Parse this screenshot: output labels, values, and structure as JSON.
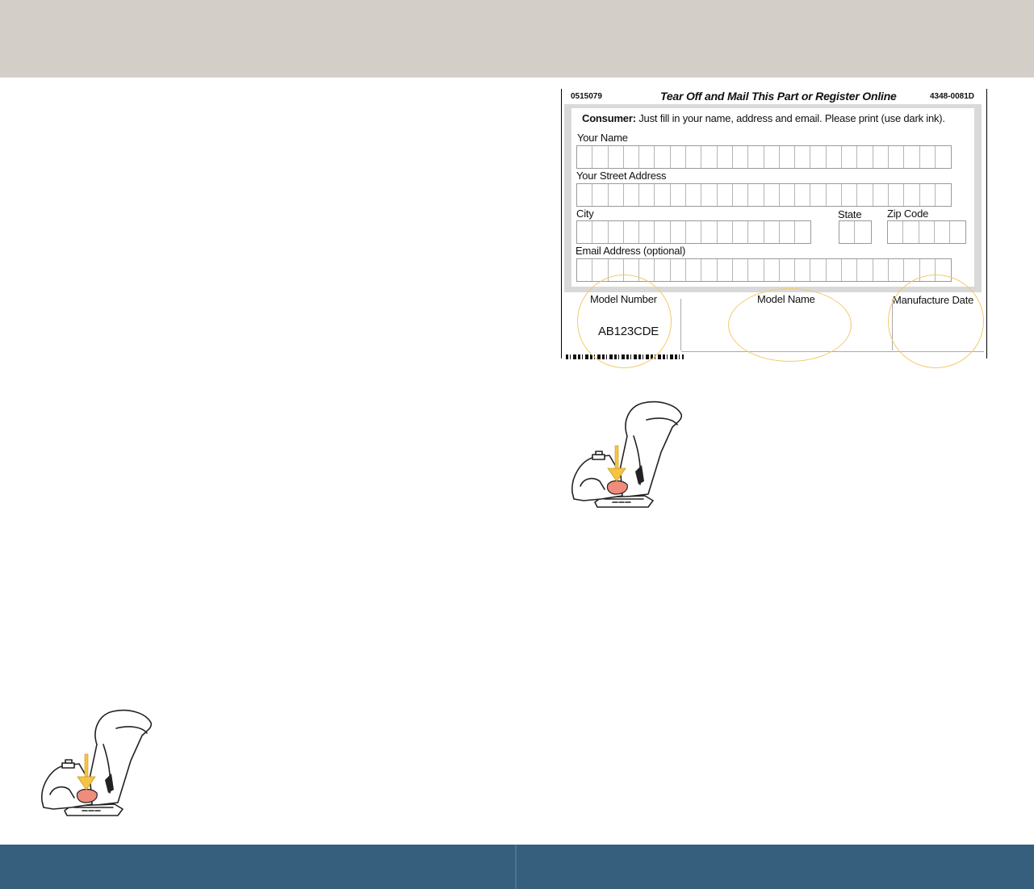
{
  "card": {
    "code_left": "0515079",
    "title": "Tear Off and Mail This Part or Register Online",
    "code_right": "4348-0081D",
    "consumer_bold": "Consumer:",
    "consumer_text": "Just fill in your name, address and email.  Please print (use dark ink).",
    "fields": {
      "name_label": "Your Name",
      "street_label": "Your Street Address",
      "city_label": "City",
      "state_label": "State",
      "zip_label": "Zip Code",
      "email_label": "Email Address (optional)"
    },
    "model_number_label": "Model Number",
    "model_number_value": "AB123CDE",
    "model_name_label": "Model Name",
    "manufacture_date_label": "Manufacture Date"
  },
  "colors": {
    "top_band": "#d3cec8",
    "bottom_band": "#365e7d",
    "highlight_circle": "#f2cb6b",
    "arrow": "#f6c443",
    "release_button": "#ef8c7c"
  },
  "illustrations": [
    "car-seat-icon",
    "down-arrow-icon"
  ]
}
